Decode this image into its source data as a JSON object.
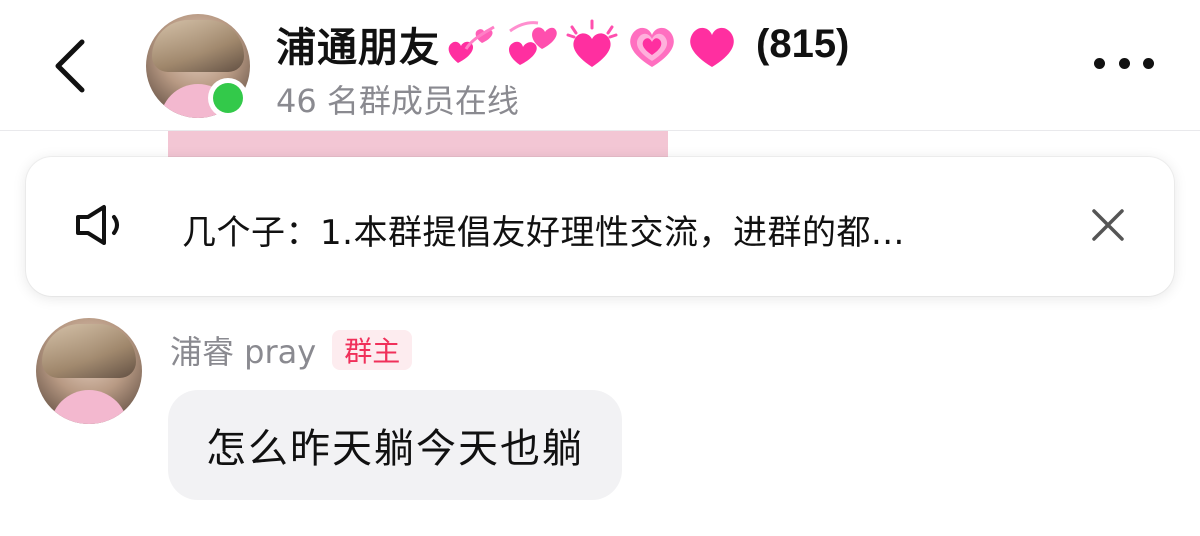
{
  "header": {
    "title": "浦通朋友",
    "member_count": "(815)",
    "subtitle": "46 名群成员在线",
    "title_emoji_icons": [
      "revolving-hearts-icon",
      "two-hearts-icon",
      "sparkling-heart-icon",
      "growing-heart-icon",
      "pink-heart-icon"
    ],
    "heart_color": "#ff2fa0",
    "online_color": "#33c94a"
  },
  "announcement": {
    "text": "几个子：1.本群提倡友好理性交流，进群的都..."
  },
  "messages": [
    {
      "sender": "浦睿 pray",
      "role": "群主",
      "text": "怎么昨天躺今天也躺"
    }
  ],
  "colors": {
    "badge_text": "#f0305a",
    "badge_bg": "#fdecef",
    "bubble_bg": "#f2f2f4",
    "secondary_text": "#8a8a90"
  }
}
